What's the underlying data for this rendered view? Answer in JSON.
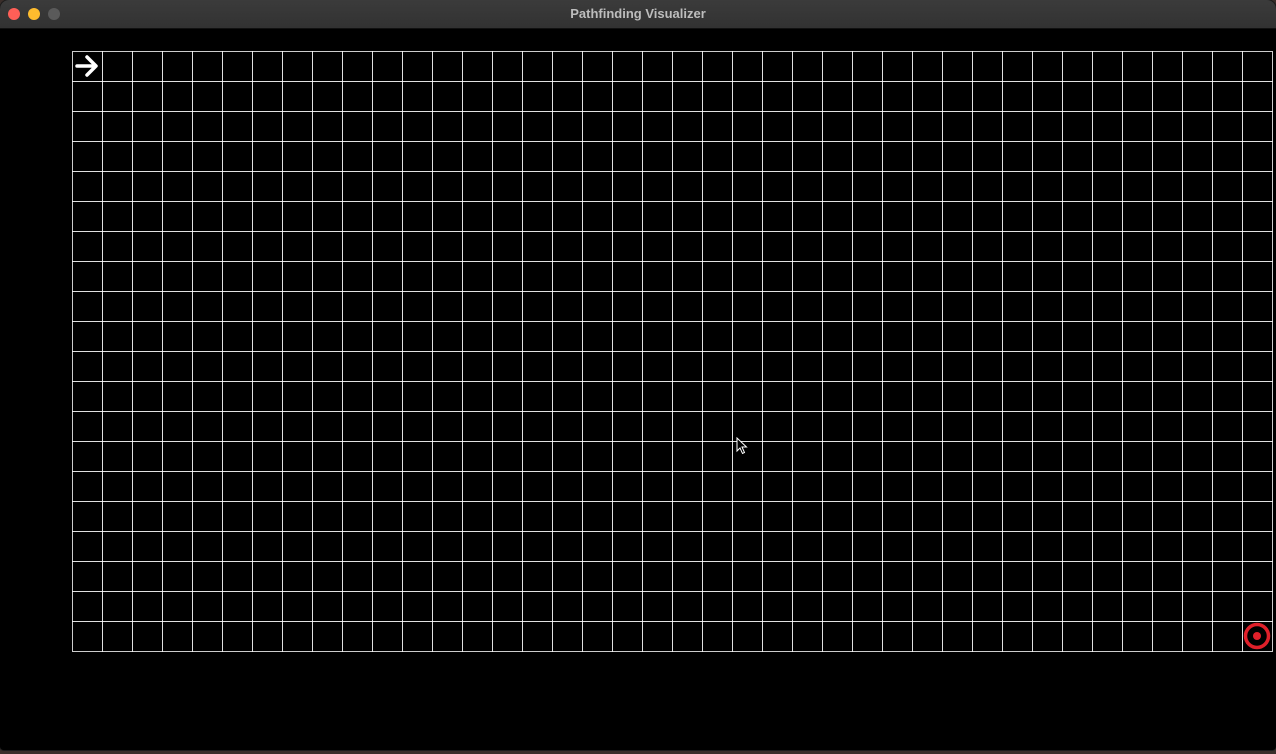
{
  "window": {
    "title": "Pathfinding Visualizer"
  },
  "grid": {
    "columns": 40,
    "rows": 20,
    "line_color": "#ffffff",
    "background_color": "#000000"
  },
  "start_node": {
    "icon": "arrow-right-icon",
    "color": "#ffffff",
    "row": 0,
    "col": 0
  },
  "end_node": {
    "icon": "target-icon",
    "color": "#e0202a",
    "row": 19,
    "col": 39
  },
  "colors": {
    "close": "#ff5f57",
    "minimize": "#febc2e",
    "zoom_inactive": "#5a5a5a"
  }
}
